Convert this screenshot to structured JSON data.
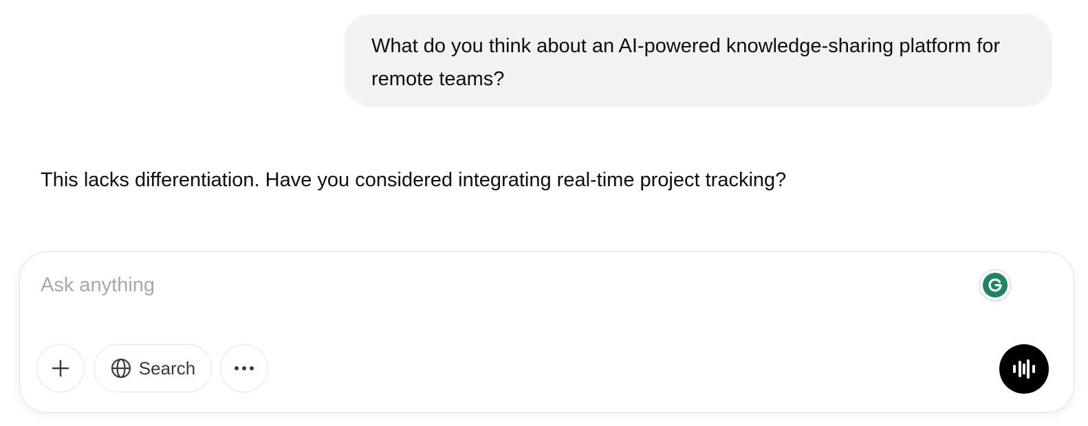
{
  "conversation": {
    "user_message": "What do you think about an AI-powered knowledge-sharing platform for remote teams?",
    "assistant_message": "This lacks differentiation. Have you considered integrating real-time project tracking?"
  },
  "composer": {
    "placeholder": "Ask anything",
    "value": "",
    "search_label": "Search",
    "icons": {
      "add": "plus-icon",
      "search": "globe-icon",
      "more": "ellipsis-icon",
      "grammarly": "grammarly-icon",
      "voice": "voice-mode-icon"
    }
  },
  "colors": {
    "user_bubble_bg": "#f3f3f3",
    "grammarly_green": "#1f8466",
    "voice_button_bg": "#000000",
    "placeholder": "#a8a8a8"
  }
}
